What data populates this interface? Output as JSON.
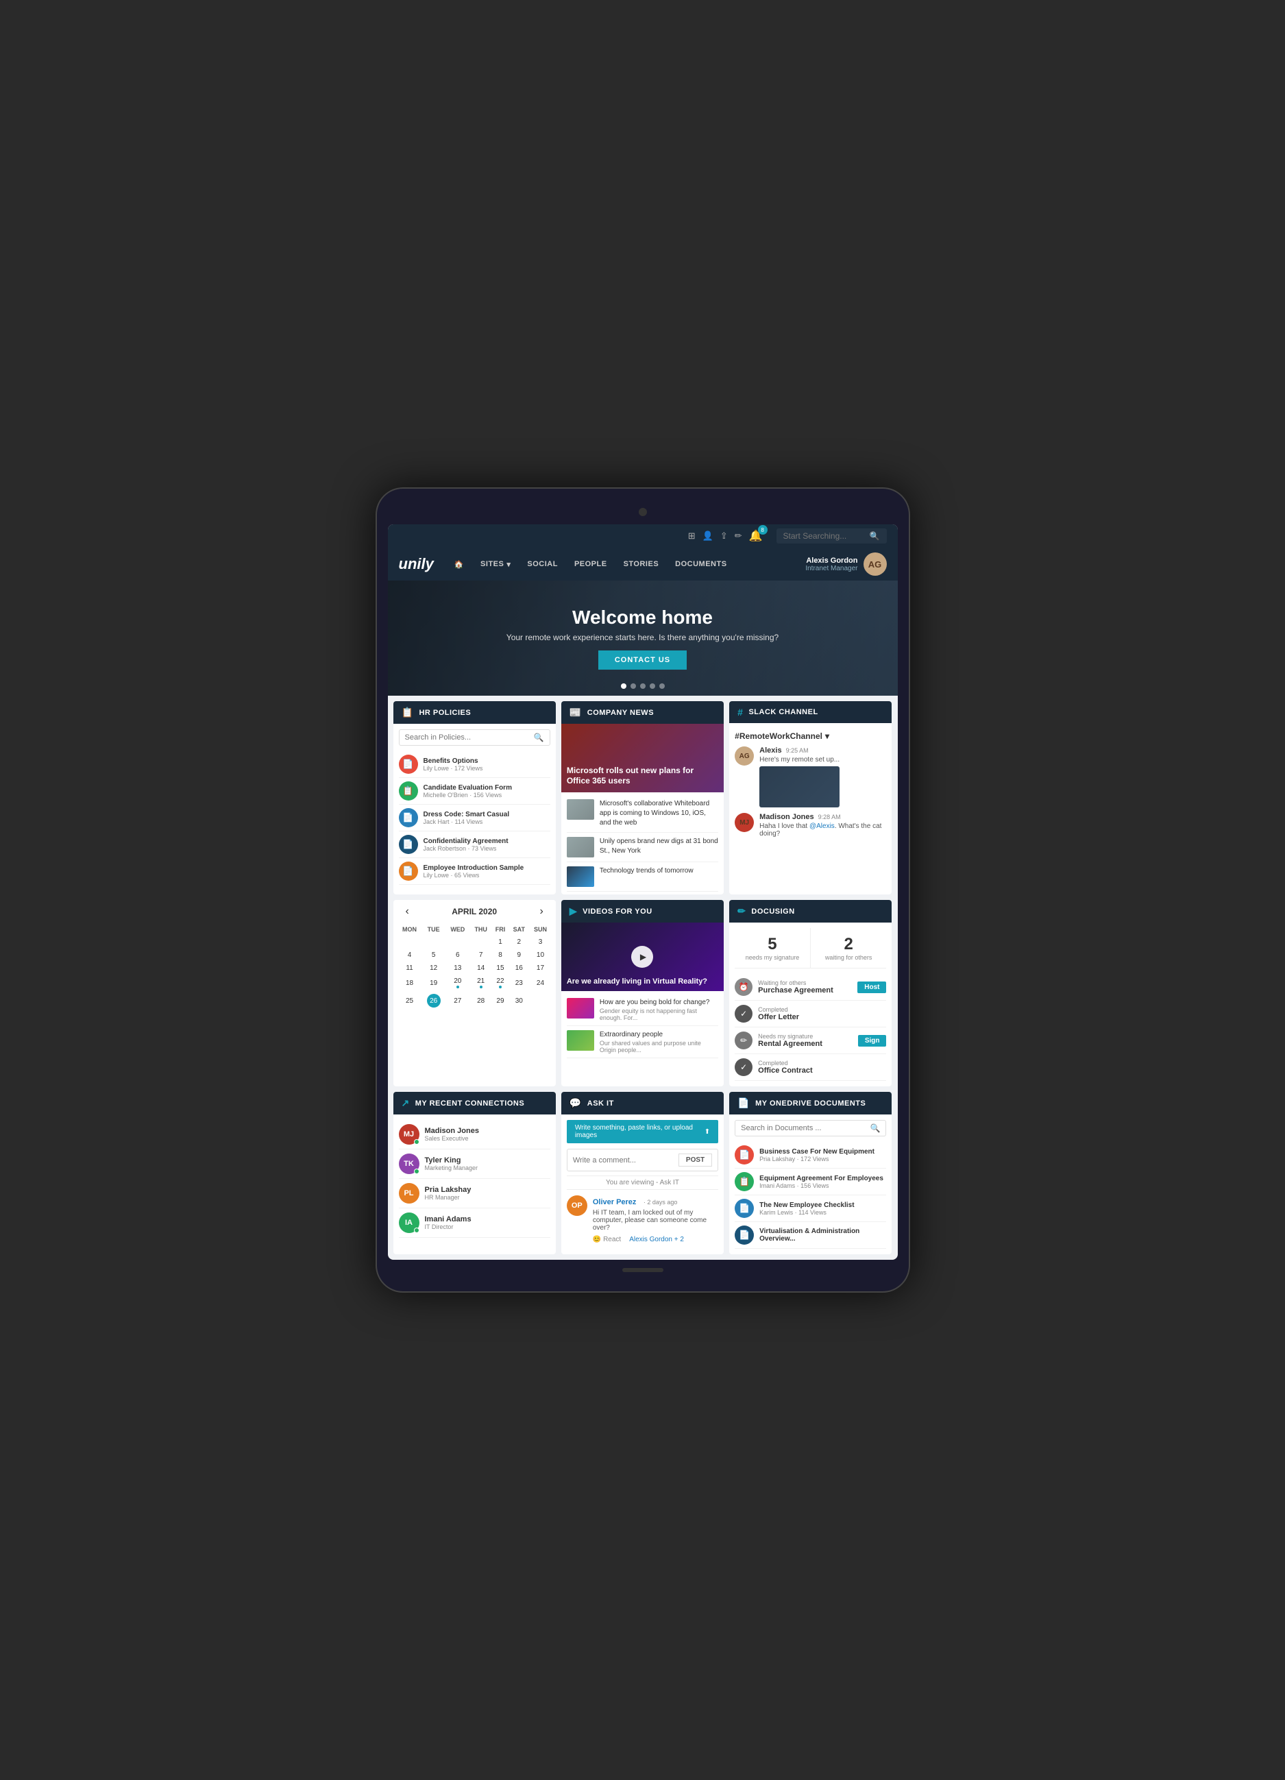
{
  "app": {
    "logo": "unily",
    "search_placeholder": "Start Searching...",
    "notification_count": "8"
  },
  "nav": {
    "home_icon": "🏠",
    "sites_label": "SITES",
    "social_label": "SOCIAL",
    "people_label": "PEOPLE",
    "stories_label": "STORIES",
    "documents_label": "DOCUMENTS",
    "user_name": "Alexis Gordon",
    "user_role": "Intranet Manager"
  },
  "hero": {
    "title": "Welcome home",
    "subtitle": "Your remote work experience starts here. Is there anything you're missing?",
    "cta": "CONTACT US"
  },
  "hr_policies": {
    "header": "HR POLICIES",
    "search_placeholder": "Search in Policies...",
    "items": [
      {
        "title": "Benefits Options",
        "meta": "Lily Lowe · 172 Views",
        "icon_type": "red",
        "icon": "📄"
      },
      {
        "title": "Candidate Evaluation Form",
        "meta": "Michelle O'Brien · 156 Views",
        "icon_type": "green",
        "icon": "📋"
      },
      {
        "title": "Dress Code: Smart Casual",
        "meta": "Jack Hart · 114 Views",
        "icon_type": "blue",
        "icon": "📄"
      },
      {
        "title": "Confidentiality Agreement",
        "meta": "Jack Robertson · 73 Views",
        "icon_type": "dark-blue",
        "icon": "📄"
      },
      {
        "title": "Employee Introduction Sample",
        "meta": "Lily Lowe · 65 Views",
        "icon_type": "orange",
        "icon": "📄"
      }
    ]
  },
  "company_news": {
    "header": "COMPANY NEWS",
    "main": {
      "title": "Microsoft rolls out new plans for Office 365 users"
    },
    "items": [
      {
        "text": "Microsoft's collaborative Whiteboard app is coming to Windows 10, iOS, and the web",
        "thumb_type": "city"
      },
      {
        "text": "Unily opens brand new digs at 31 bond St., New York",
        "thumb_type": "city"
      },
      {
        "text": "Technology trends of tomorrow",
        "thumb_type": "tech"
      }
    ]
  },
  "slack": {
    "header": "SLACK CHANNEL",
    "channel": "#RemoteWorkChannel",
    "messages": [
      {
        "name": "Alexis",
        "time": "9:25 AM",
        "text": "Here's my remote set up...",
        "has_image": true
      },
      {
        "name": "Madison Jones",
        "time": "9:28 AM",
        "text": "Haha I love that @Alexis. What's the cat doing?"
      }
    ]
  },
  "calendar": {
    "header": "APRIL 2020",
    "days": [
      "MON",
      "TUE",
      "WED",
      "THU",
      "FRI",
      "SAT",
      "SUN"
    ],
    "weeks": [
      [
        null,
        null,
        null,
        null,
        "1",
        "2",
        "3"
      ],
      [
        "4",
        "5",
        "6",
        "7",
        "8",
        "9",
        "10"
      ],
      [
        "11",
        "12",
        "13",
        "14",
        "15",
        "16",
        "17"
      ],
      [
        "18",
        "19",
        "20",
        "21",
        "22",
        "23",
        "24"
      ],
      [
        "25",
        "26",
        "27",
        "28",
        "29",
        "30",
        null
      ]
    ],
    "today": "26",
    "dots": [
      "20",
      "21",
      "22"
    ]
  },
  "videos": {
    "header": "VIDEOS FOR YOU",
    "main_title": "Are we already living in Virtual Reality?",
    "items": [
      {
        "title": "How are you being bold for change?",
        "sub": "Gender equity is not happening fast enough. For...",
        "thumb_type": "pink"
      },
      {
        "title": "Extraordinary people",
        "sub": "Our shared values and purpose unite Origin people...",
        "thumb_type": "nature"
      }
    ]
  },
  "docusign": {
    "header": "DOCUSIGN",
    "stats": [
      {
        "num": "5",
        "label": "needs my signature"
      },
      {
        "num": "2",
        "label": "waiting for others"
      }
    ],
    "items": [
      {
        "status": "Waiting for others",
        "name": "Purchase Agreement",
        "icon_type": "clock",
        "icon": "⏰",
        "action": "Host",
        "action_type": "host"
      },
      {
        "status": "Completed",
        "name": "Offer Letter",
        "icon_type": "check",
        "icon": "✓",
        "action": null
      },
      {
        "status": "Needs my signature",
        "name": "Rental Agreement",
        "icon_type": "pen",
        "icon": "✏️",
        "action": "Sign",
        "action_type": "sign"
      },
      {
        "status": "Completed",
        "name": "Office Contract",
        "icon_type": "check",
        "icon": "✓",
        "action": null
      }
    ]
  },
  "connections": {
    "header": "MY RECENT CONNECTIONS",
    "items": [
      {
        "name": "Madison Jones",
        "role": "Sales Executive",
        "avatar_type": "mj",
        "initials": "MJ",
        "online": true
      },
      {
        "name": "Tyler King",
        "role": "Marketing Manager",
        "avatar_type": "tk",
        "initials": "TK",
        "online": true
      },
      {
        "name": "Pria Lakshay",
        "role": "HR Manager",
        "avatar_type": "pl",
        "initials": "PL",
        "online": false
      },
      {
        "name": "Imani Adams",
        "role": "IT Director",
        "avatar_type": "ia",
        "initials": "IA",
        "online": true
      }
    ]
  },
  "ask_it": {
    "header": "ASK IT",
    "upload_label": "Write something, paste links, or upload images",
    "comment_placeholder": "Write a comment...",
    "post_label": "POST",
    "viewing_label": "You are viewing - Ask IT",
    "post": {
      "name": "Oliver Perez",
      "time": "· 2 days ago",
      "text": "Hi IT team, I am locked out of my computer, please can someone come over?",
      "reactions": "React",
      "replies": "Alexis Gordon + 2"
    }
  },
  "onedrive": {
    "header": "MY ONEDRIVE DOCUMENTS",
    "search_placeholder": "Search in Documents ...",
    "items": [
      {
        "title": "Business Case For New Equipment",
        "meta": "Pria Lakshay · 172 Views",
        "icon_type": "red",
        "icon": "📄"
      },
      {
        "title": "Equipment Agreement For Employees",
        "meta": "Imani Adams · 156 Views",
        "icon_type": "green",
        "icon": "📋"
      },
      {
        "title": "The New Employee Checklist",
        "meta": "Karim Lewis · 114 Views",
        "icon_type": "blue",
        "icon": "📄"
      },
      {
        "title": "Virtualisation & Administration Overview...",
        "meta": "",
        "icon_type": "dark-blue",
        "icon": "📄"
      }
    ]
  }
}
